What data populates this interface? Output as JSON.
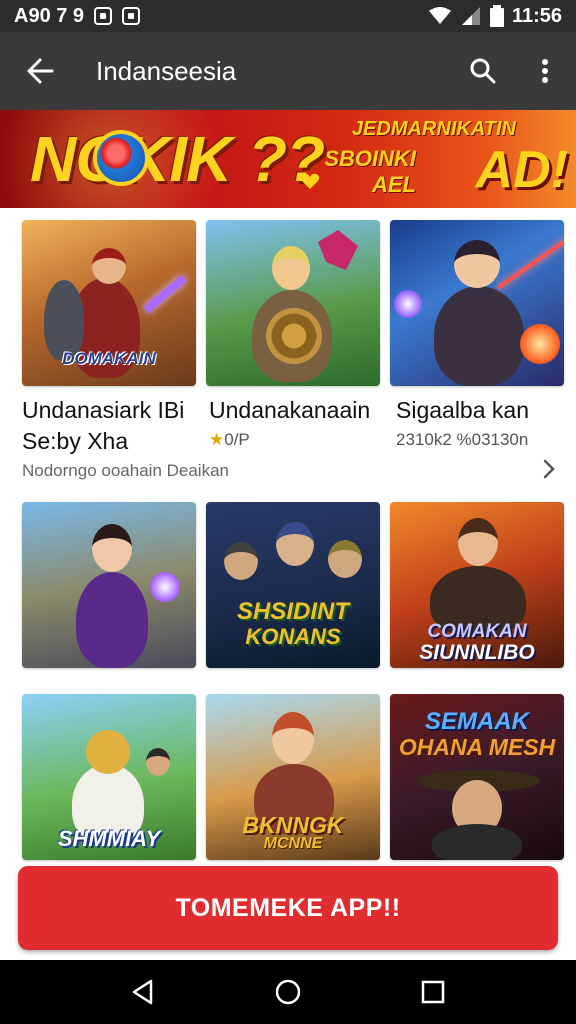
{
  "status_bar": {
    "left_text": "A90 7 9",
    "time": "11:56"
  },
  "app_bar": {
    "title": "Indanseesia"
  },
  "banner": {
    "logo": "NOKIK ??",
    "tag_line1": "JEDMARNIKATIN",
    "tag_line2": "SBOINKI",
    "tag_line3": "AEL",
    "tag_big": "AD!"
  },
  "row1": [
    {
      "art_text": "DOMAKAIN",
      "title": "Undanasiark IBi",
      "subtitle": "Se:by Xha"
    },
    {
      "art_text": "",
      "title": "Undanakanaain",
      "subtitle": "★0/P"
    },
    {
      "art_text": "",
      "title": "Sigaalba kan",
      "subtitle": "2310k2 %03130n"
    }
  ],
  "section_label": "Nodorngo ooahain Deaikan",
  "row2": [
    {
      "art_text": ""
    },
    {
      "art_text_1": "SHSIDINT",
      "art_text_2": "KONANS"
    },
    {
      "art_text_1": "COMAKAN",
      "art_text_2": "SIUNNLIBO"
    }
  ],
  "row3": [
    {
      "art_text": "SHMMIAY"
    },
    {
      "art_text_1": "BKNNGK",
      "art_text_2": "MCNNE"
    },
    {
      "art_text_1": "SEMAAK",
      "art_text_2": "OHANA MESH"
    }
  ],
  "install_button": {
    "label": "TOMEMEKE APP!!"
  },
  "colors": {
    "accent": "#e02b2f",
    "app_bar": "#3a3a3a",
    "status_bar": "#2c2c2c"
  }
}
